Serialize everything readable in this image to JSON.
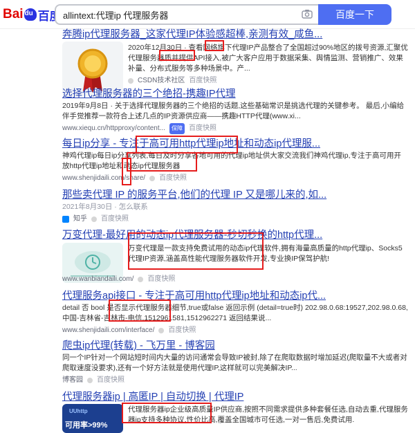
{
  "header": {
    "logo_bai": "Bai",
    "logo_cn": "百度",
    "search_value": "allintext:代理ip 代理服务器",
    "search_button": "百度一下"
  },
  "results": [
    {
      "title": "奔腾ip代理服务器_这家代理IP体验感超棒,亲测有效_咸鱼...",
      "desc": "2020年12月30日 · 查看网络旗下代理IP产品整合了全国超过90%地区的拨号资源,汇聚优代理服务器质并提供API接入,被广大客户应用于数据采集、舆情监测、营销推广、效果补量、分布式服务等多种场景中。产...",
      "source": "CSDN技术社区",
      "snapshot": "百度快照"
    },
    {
      "title": "选择代理服务器的三个绝招-携趣IP代理",
      "desc": "2019年9月8日 · 关于选择代理服务器的三个绝招的话题,这些基础常识是挑选代理的关键参考。 最后,小编给伴手觉推荐一款符合上述几点的IP资源供应商——携趣HTTP代理(www.xi...",
      "source": "www.xiequ.cn/httpproxy/content...",
      "badge": "保障",
      "snapshot": "百度快照"
    },
    {
      "title": "每日ip分享 - 专注于高可用http代理ip地址和动态ip代理服...",
      "desc": "神鸡代理ip每日ip分享列表,每日及时分享各地可用的代理ip地址供大家交流我们神鸡代理ip,专注于高可用开放http代理ip地址和动态ip代理服务器",
      "source": "www.shenjidaili.com/share/",
      "snapshot": "百度快照"
    },
    {
      "title": "那些卖代理 IP 的服务平台,他们的代理 IP 又是哪儿来的,如...",
      "desc": "2021年8月30日 · 怎么联系",
      "source": "知乎",
      "snapshot": "百度快照"
    },
    {
      "title": "万变代理-最好用的动态ip代理服务器-秒切秒换的http代理...",
      "desc": "万变代理是一款支持免费试用的动态ip代理软件,拥有海量高质量的http代理ip、Socks5代理IP资源,涵盖高性能代理服务器软件开发,专业换IP保驾护航!",
      "source": "www.wanbiandaili.com/",
      "snapshot": "百度快照"
    },
    {
      "title": "代理服务api接口 - 专注于高可用http代理ip地址和动态ip代...",
      "desc": "detail 否 bool 是否显示代理服务器细节,true或false 返回示例 (detail=true时) 202.98.0.68:19527,202.98.0.68,中国-吉林省-吉林市-电信,1512961581,1512962271 返回结果说...",
      "source": "www.shenjidaili.com/interface/",
      "snapshot": "百度快照"
    },
    {
      "title": "爬虫ip代理(转载) - 飞万里 - 博客园",
      "desc": "同一个IP针对一个网站短时间内大量的访问通常会导致IP被封,除了在爬取数据时增加延迟(爬取量不大或者对爬取速度没要求),还有一个好方法就是使用代理IP,这样就可以完美解决IP...",
      "source": "博客园",
      "snapshot": "百度快照"
    },
    {
      "title": "代理服务器ip | 高匿IP | 自动切换 | 代理IP",
      "desc": "代理服务器ip企业级高质量IP供应商,按照不同需求提供多种套餐任选,自动去重,代理服务器ip支持多种协议,性价比高,覆盖全国城市可任选,一对一售后,免费试用.",
      "thumb_text": "可用率>99%",
      "thumb_brand": "UUhttp"
    }
  ]
}
